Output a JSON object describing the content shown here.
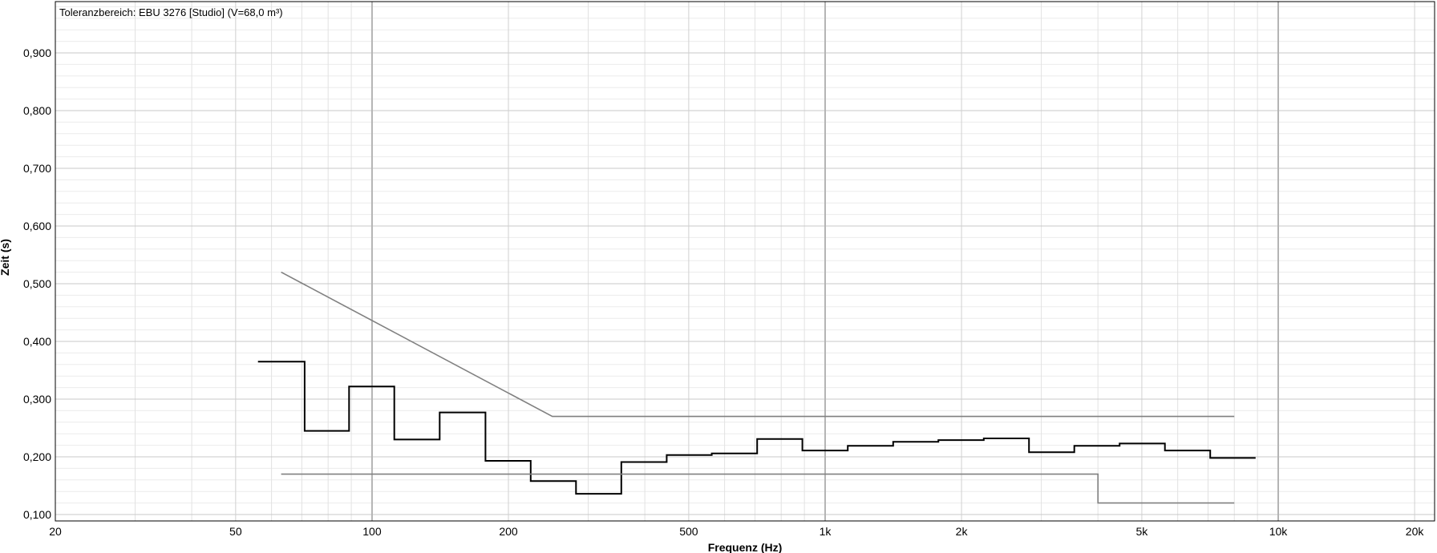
{
  "chart_data": {
    "type": "line",
    "title": "Toleranzbereich: EBU 3276 [Studio] (V=68,0 m³)",
    "xlabel": "Frequenz (Hz)",
    "ylabel": "Zeit (s)",
    "x_scale": "log",
    "xlim": [
      20,
      25000
    ],
    "ylim": [
      0,
      1.0
    ],
    "grid": true,
    "x_ticks": [
      {
        "value": 20,
        "label": "20"
      },
      {
        "value": 50,
        "label": "50"
      },
      {
        "value": 100,
        "label": "100"
      },
      {
        "value": 200,
        "label": "200"
      },
      {
        "value": 500,
        "label": "500"
      },
      {
        "value": 1000,
        "label": "1k"
      },
      {
        "value": 2000,
        "label": "2k"
      },
      {
        "value": 5000,
        "label": "5k"
      },
      {
        "value": 10000,
        "label": "10k"
      },
      {
        "value": 20000,
        "label": "20k"
      }
    ],
    "y_ticks": [
      {
        "value": 0.1,
        "label": "0,100"
      },
      {
        "value": 0.2,
        "label": "0,200"
      },
      {
        "value": 0.3,
        "label": "0,300"
      },
      {
        "value": 0.4,
        "label": "0,400"
      },
      {
        "value": 0.5,
        "label": "0,500"
      },
      {
        "value": 0.6,
        "label": "0,600"
      },
      {
        "value": 0.7,
        "label": "0,700"
      },
      {
        "value": 0.8,
        "label": "0,800"
      },
      {
        "value": 0.9,
        "label": "0,900"
      }
    ],
    "series": [
      {
        "style": "step",
        "color": "#000000",
        "edges": [
          56,
          71,
          89,
          112,
          141,
          178,
          224,
          282,
          355,
          447,
          562,
          708,
          891,
          1122,
          1413,
          1778,
          2239,
          2818,
          3548,
          4467,
          5623,
          7079,
          8913
        ],
        "values": [
          0.365,
          0.245,
          0.322,
          0.23,
          0.277,
          0.193,
          0.158,
          0.136,
          0.191,
          0.203,
          0.206,
          0.231,
          0.211,
          0.219,
          0.226,
          0.229,
          0.232,
          0.208,
          0.219,
          0.223,
          0.211,
          0.198
        ]
      },
      {
        "style": "line",
        "color": "#808080",
        "x": [
          63,
          250,
          8000
        ],
        "y": [
          0.52,
          0.27,
          0.27
        ]
      },
      {
        "style": "line",
        "color": "#808080",
        "x": [
          63,
          4000,
          4000,
          8000
        ],
        "y": [
          0.17,
          0.17,
          0.12,
          0.12
        ]
      }
    ]
  }
}
